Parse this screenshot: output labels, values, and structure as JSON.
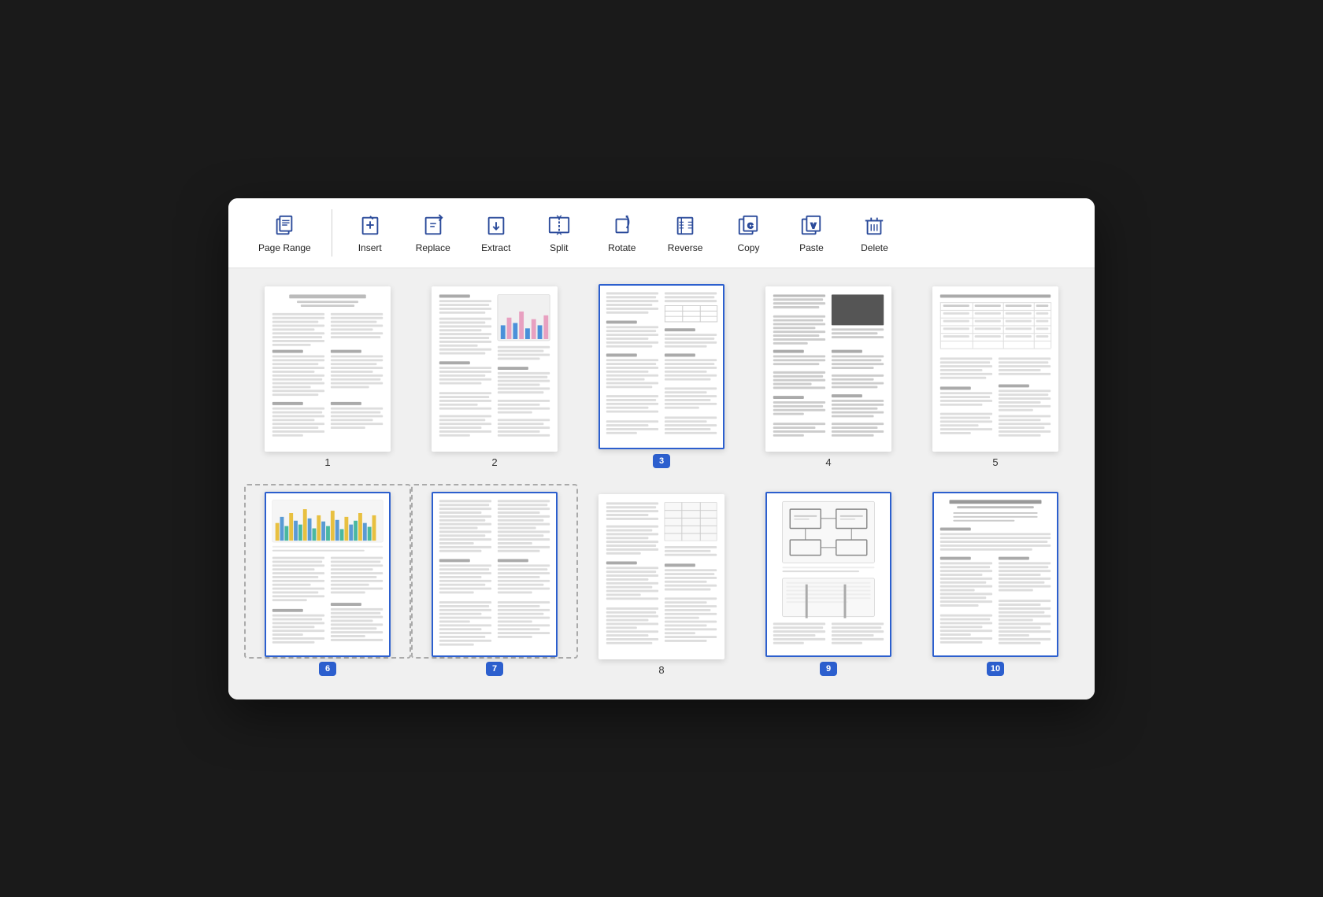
{
  "toolbar": {
    "items": [
      {
        "id": "page-range",
        "label": "Page Range",
        "icon": "page-range-icon"
      },
      {
        "id": "insert",
        "label": "Insert",
        "icon": "insert-icon"
      },
      {
        "id": "replace",
        "label": "Replace",
        "icon": "replace-icon"
      },
      {
        "id": "extract",
        "label": "Extract",
        "icon": "extract-icon"
      },
      {
        "id": "split",
        "label": "Split",
        "icon": "split-icon"
      },
      {
        "id": "rotate",
        "label": "Rotate",
        "icon": "rotate-icon"
      },
      {
        "id": "reverse",
        "label": "Reverse",
        "icon": "reverse-icon"
      },
      {
        "id": "copy",
        "label": "Copy",
        "icon": "copy-icon"
      },
      {
        "id": "paste",
        "label": "Paste",
        "icon": "paste-icon"
      },
      {
        "id": "delete",
        "label": "Delete",
        "icon": "delete-icon"
      }
    ]
  },
  "pages": {
    "row1": [
      {
        "number": "",
        "label": "1",
        "selected": false,
        "badged": false,
        "type": "text-doc"
      },
      {
        "number": "",
        "label": "2",
        "selected": false,
        "badged": false,
        "type": "text-chart"
      },
      {
        "number": "3",
        "label": "3",
        "selected": true,
        "badged": true,
        "type": "text-doc"
      },
      {
        "number": "4",
        "label": "4",
        "selected": false,
        "badged": false,
        "type": "text-dark"
      },
      {
        "number": "5",
        "label": "5",
        "selected": false,
        "badged": false,
        "type": "text-table"
      }
    ],
    "row2": [
      {
        "number": "6",
        "label": "6",
        "selected": true,
        "badged": true,
        "type": "chart-doc",
        "dashed": true
      },
      {
        "number": "7",
        "label": "7",
        "selected": true,
        "badged": true,
        "type": "text-doc",
        "dashed": true
      },
      {
        "number": "8",
        "label": "8",
        "selected": false,
        "badged": false,
        "type": "text-doc2"
      },
      {
        "number": "9",
        "label": "9",
        "selected": true,
        "badged": true,
        "type": "diagram"
      },
      {
        "number": "10",
        "label": "10",
        "selected": true,
        "badged": true,
        "type": "text-title"
      }
    ]
  }
}
